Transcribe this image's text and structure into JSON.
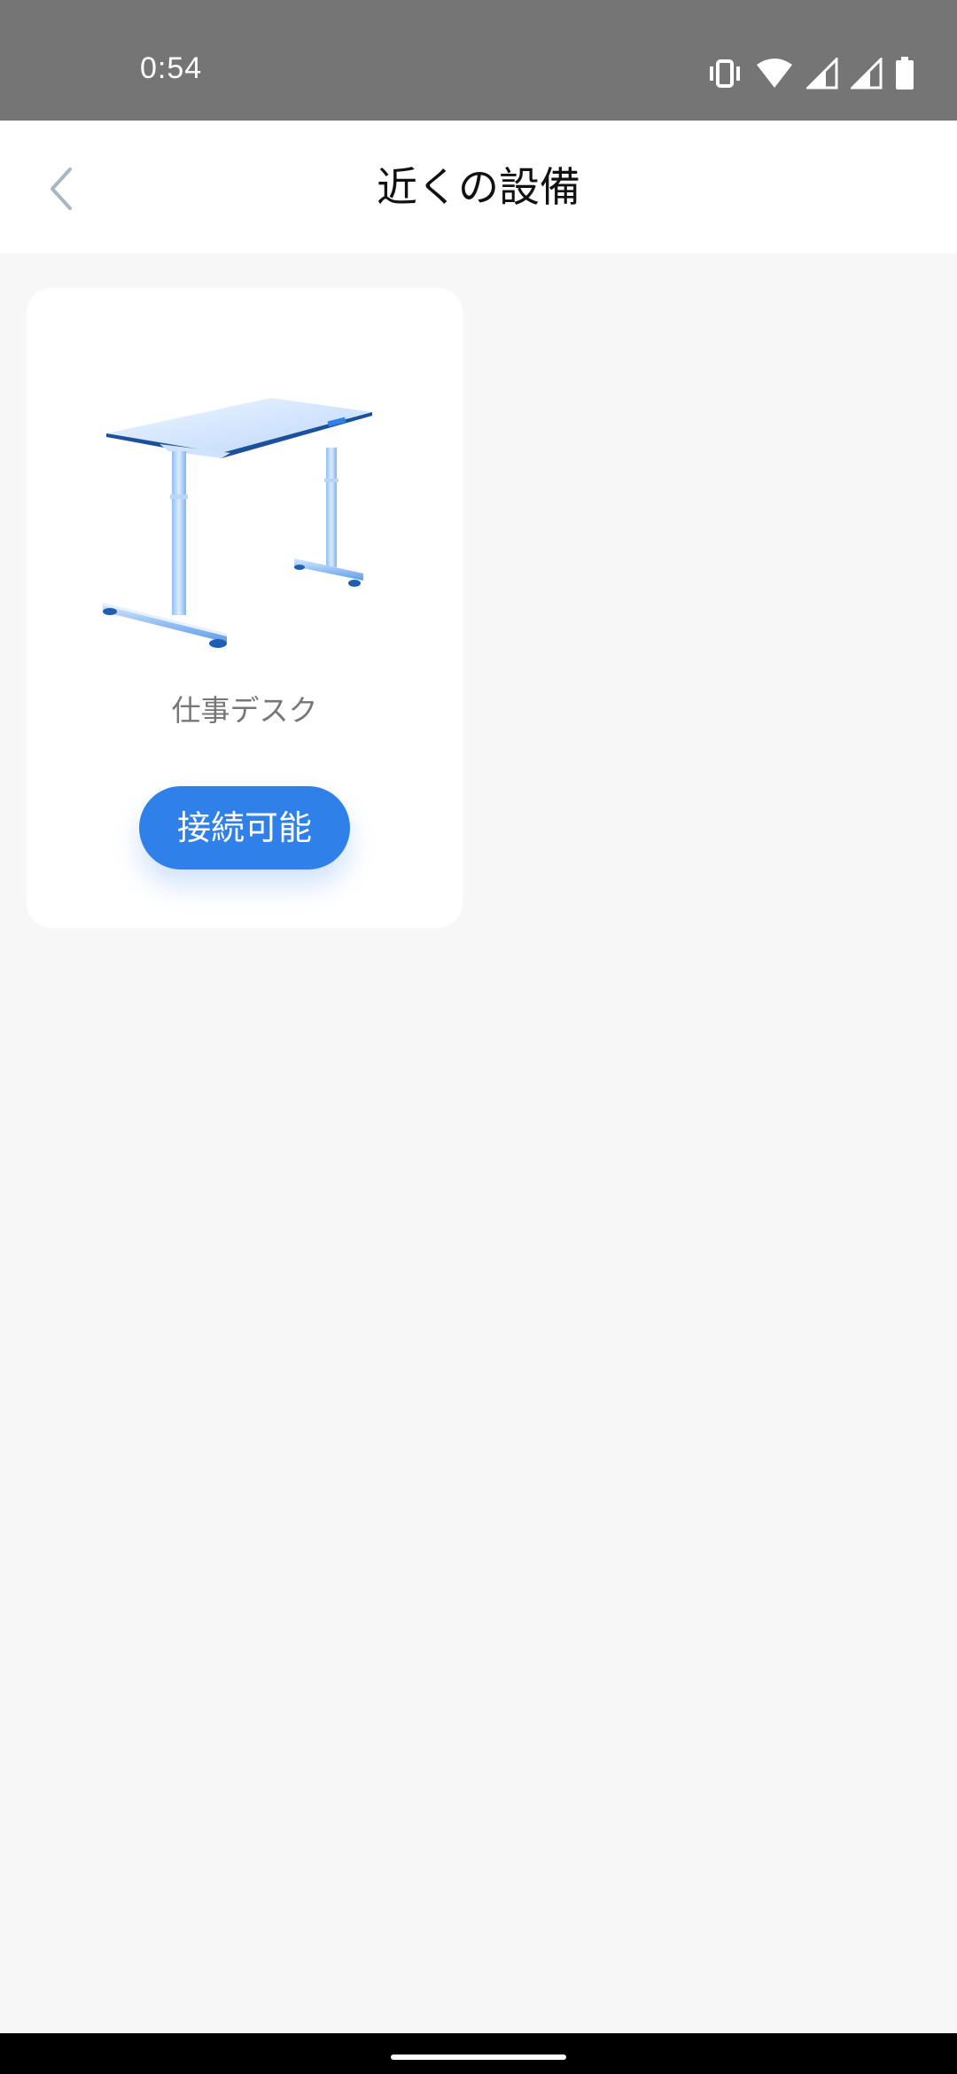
{
  "status_bar": {
    "time": "0:54",
    "icons": [
      "vibrate-icon",
      "wifi-icon",
      "cell-signal-icon",
      "cell-signal-icon",
      "battery-icon"
    ]
  },
  "header": {
    "title": "近くの設備",
    "back_icon": "chevron-left-icon"
  },
  "devices": [
    {
      "name": "仕事デスク",
      "image": "standing-desk-image",
      "action_label": "接続可能"
    }
  ],
  "colors": {
    "accent": "#2f80e8",
    "background": "#f7f7f7",
    "status_bar": "#757575",
    "card": "#ffffff"
  }
}
